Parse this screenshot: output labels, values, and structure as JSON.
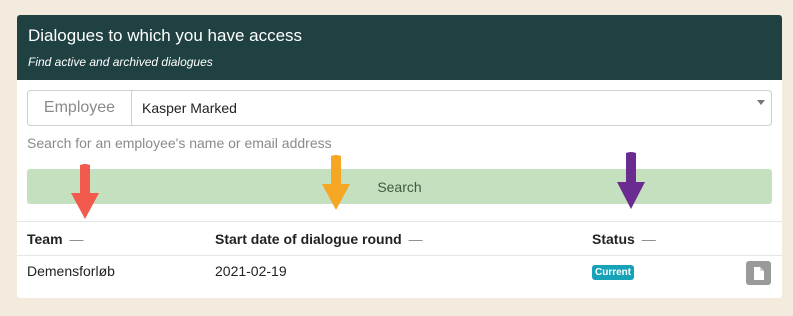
{
  "header": {
    "title": "Dialogues to which you have access",
    "subtitle": "Find active and archived dialogues"
  },
  "employee_select": {
    "addon_label": "Employee",
    "selected_value": "Kasper Marked",
    "help_text": "Search for an employee's name or email address"
  },
  "search_button": {
    "label": "Search"
  },
  "table": {
    "columns": [
      "Team",
      "Start date of dialogue round",
      "Status"
    ],
    "sort_indicator": "—",
    "rows": [
      {
        "team": "Demensforløb",
        "start_date": "2021-02-19",
        "status": "Current"
      }
    ]
  },
  "colors": {
    "header_bg": "#1f4141",
    "search_button_bg": "#c5e0bf",
    "status_badge": "#17a2b8",
    "arrow_red": "#f15a4c",
    "arrow_orange": "#f5a623",
    "arrow_purple": "#6b2c91"
  },
  "annotations": [
    "red-arrow",
    "orange-arrow",
    "purple-arrow"
  ]
}
